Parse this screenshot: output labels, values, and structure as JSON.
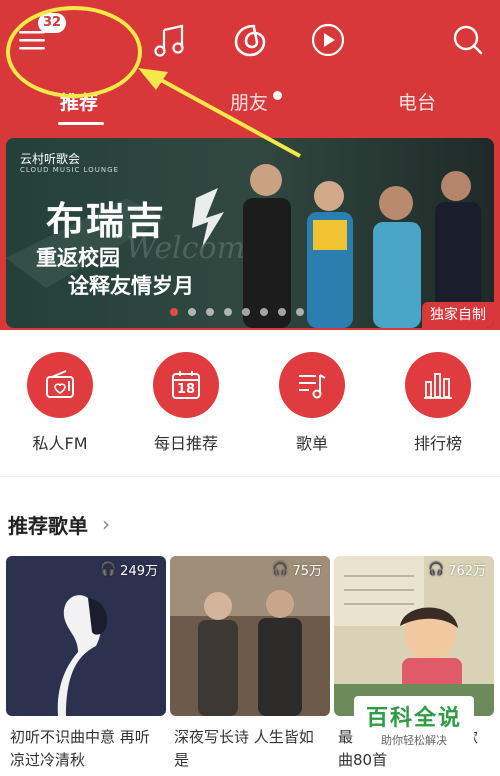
{
  "topbar": {
    "menu_icon": "menu-icon",
    "badge_count": "32",
    "music_icon": "music-note-icon",
    "netease_icon": "netease-logo-icon",
    "video_icon": "play-video-icon",
    "search_icon": "search-icon"
  },
  "tabs": [
    {
      "label": "推荐",
      "active": true
    },
    {
      "label": "朋友",
      "active": false,
      "has_dot": true
    },
    {
      "label": "电台",
      "active": false
    }
  ],
  "banner": {
    "brand": "云村听歌会",
    "brand_sub": "CLOUD MUSIC LOUNGE",
    "title": "布瑞吉",
    "subtitle_line1": "重返校园",
    "subtitle_line2": "诠释友情岁月",
    "tag": "独家自制",
    "active_dot": 0,
    "dot_count": 8
  },
  "quick_entries": [
    {
      "label": "私人FM",
      "icon": "radio-icon"
    },
    {
      "label": "每日推荐",
      "icon": "calendar-icon",
      "day": "18"
    },
    {
      "label": "歌单",
      "icon": "playlist-icon"
    },
    {
      "label": "排行榜",
      "icon": "chart-bars-icon"
    }
  ],
  "section": {
    "title": "推荐歌单",
    "chevron": "›"
  },
  "playlists": [
    {
      "plays": "249万",
      "title": "初听不识曲中意 再听凉过冷清秋"
    },
    {
      "plays": "75万",
      "title": "深夜写长诗 人生皆如是"
    },
    {
      "plays": "762万",
      "title": "最美中文歌曲 英文歌曲80首"
    }
  ],
  "watermark": {
    "title": "百科全说",
    "subtitle": "助你轻松解决"
  },
  "colors": {
    "brand_red": "#d8383a",
    "annotation_yellow": "#f4e84a",
    "watermark_green": "#2f9b45"
  }
}
